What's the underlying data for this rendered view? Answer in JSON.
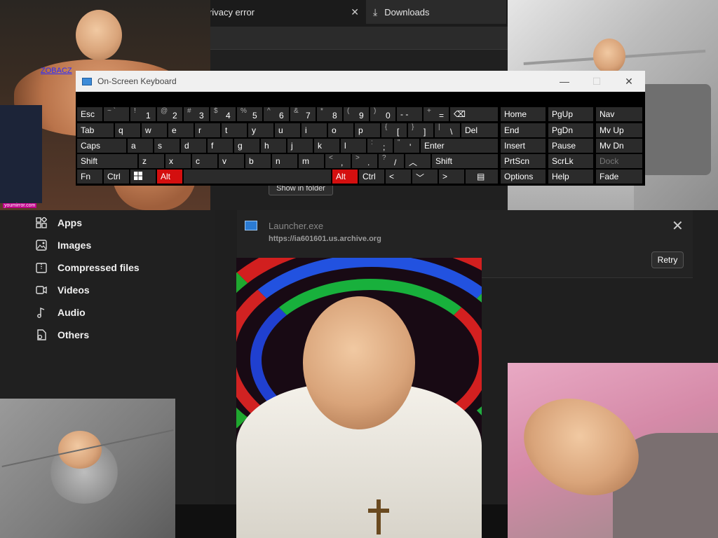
{
  "browser": {
    "tabs": [
      {
        "label": "rivacy error"
      },
      {
        "label": "Downloads"
      }
    ],
    "sidebar": [
      {
        "label": "Apps",
        "icon": "apps-icon"
      },
      {
        "label": "Images",
        "icon": "image-icon"
      },
      {
        "label": "Compressed files",
        "icon": "archive-icon"
      },
      {
        "label": "Videos",
        "icon": "video-icon"
      },
      {
        "label": "Audio",
        "icon": "music-icon"
      },
      {
        "label": "Others",
        "icon": "file-icon"
      }
    ],
    "download": {
      "file_name": "Launcher.exe",
      "url": "https://ia601601.us.archive.org",
      "retry_label": "Retry",
      "show_folder_label": "Show in folder"
    }
  },
  "osk": {
    "title": "On-Screen Keyboard",
    "title_buttons": {
      "minimize": "—",
      "maximize": "☐",
      "close": "✕"
    }
  },
  "overlay": {
    "link_text": "ZOBACZ",
    "credit": "youmirror.com"
  },
  "colors": {
    "alt_key": "#d40f0f",
    "background": "#202020"
  }
}
